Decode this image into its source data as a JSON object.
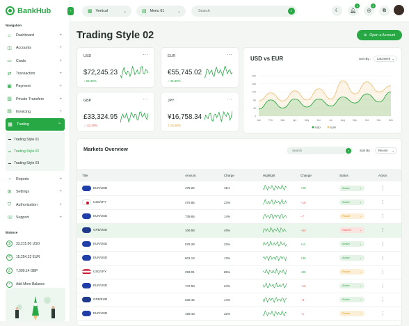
{
  "brand": {
    "name": "BankHub"
  },
  "sidebar": {
    "nav_title": "Navigation",
    "items": [
      {
        "label": "Dashboard",
        "icon": "home-icon"
      },
      {
        "label": "Accounts",
        "icon": "wallet-icon"
      },
      {
        "label": "Cards",
        "icon": "card-icon"
      },
      {
        "label": "Transaction",
        "icon": "transfer-icon"
      },
      {
        "label": "Payment",
        "icon": "payment-icon"
      },
      {
        "label": "Private Transfers",
        "icon": "bar-icon"
      },
      {
        "label": "Invoicing",
        "icon": "invoice-icon"
      },
      {
        "label": "Trading",
        "icon": "trading-icon"
      }
    ],
    "sub_items": [
      "Trading Style 01",
      "Trading Style 02",
      "Trading Style 03"
    ],
    "more_items": [
      {
        "label": "Reports",
        "icon": "reports-icon"
      },
      {
        "label": "Settings",
        "icon": "gear-icon"
      },
      {
        "label": "Authorization",
        "icon": "shield-icon"
      },
      {
        "label": "Support",
        "icon": "support-icon"
      }
    ],
    "balance_title": "Balance",
    "balances": [
      {
        "symbol": "$",
        "text": "33,215.00 USD"
      },
      {
        "symbol": "€",
        "text": "15,254.32 EUR"
      },
      {
        "symbol": "£",
        "text": "7,009.14 GBP"
      },
      {
        "symbol": "+",
        "text": "Add More Balance"
      }
    ]
  },
  "topbar": {
    "dropdown1": "Vertical",
    "dropdown2": "Menu 01",
    "search_placeholder": "Search",
    "badges": [
      "1",
      "2"
    ]
  },
  "page": {
    "title": "Trading Style 02",
    "open_account": "Open a Account"
  },
  "currency_cards": [
    {
      "code": "USD",
      "amount": "$72,245.23",
      "change": "↑ 28.30%",
      "trend": "up"
    },
    {
      "code": "EUR",
      "amount": "€55,745.02",
      "change": "↑ 45.30%",
      "trend": "up"
    },
    {
      "code": "GBP",
      "amount": "£33,324.95",
      "change": "↓ -12.30%",
      "trend": "down"
    },
    {
      "code": "JPY",
      "amount": "¥16,758.34",
      "change": "‡ 10.30%",
      "trend": "warn"
    }
  ],
  "chart_data": {
    "type": "area",
    "title": "USD vs EUR",
    "categories": [
      "Jan",
      "Feb",
      "Mar",
      "Apr",
      "May",
      "Jun",
      "Jul",
      "Aug",
      "Sep",
      "Oct",
      "Nov",
      "Dec"
    ],
    "ylim": [
      0,
      200
    ],
    "yticks": [
      0,
      40,
      80,
      120,
      160,
      200
    ],
    "series": [
      {
        "name": "USD",
        "color": "#27a844",
        "values": [
          35,
          80,
          40,
          85,
          45,
          85,
          50,
          95,
          65,
          110,
          70,
          120
        ]
      },
      {
        "name": "EUR",
        "color": "#f0c27b",
        "values": [
          75,
          115,
          75,
          125,
          80,
          135,
          85,
          175,
          110,
          170,
          120,
          150
        ]
      }
    ],
    "legend": "bottom",
    "grid": true
  },
  "chart_sort": {
    "label": "Sort By :",
    "value": "Last week"
  },
  "markets": {
    "title": "Markets Overview",
    "search_placeholder": "Search",
    "sort_label": "Sort By :",
    "sort_value": "Recent",
    "headers": [
      "Title",
      "Amount",
      "Charge",
      "Highlight",
      "Change",
      "Status",
      "Action"
    ],
    "rows": [
      {
        "title": "EUR/USD",
        "flag": "eu",
        "amount": "475.22",
        "charge": "11%",
        "change": "+25",
        "dir": "up",
        "status": "Active"
      },
      {
        "title": "USD/JPY",
        "flag": "jp",
        "amount": "475.85",
        "charge": "23%",
        "change": "−15",
        "dir": "down",
        "status": "Active"
      },
      {
        "title": "EUR/USD",
        "flag": "eu",
        "amount": "739.65",
        "charge": "14%",
        "change": "−7",
        "dir": "down",
        "status": "Pause"
      },
      {
        "title": "GPB/USD",
        "flag": "gb",
        "amount": "106.58",
        "charge": "45%",
        "change": "−54",
        "dir": "down",
        "status": "Cancel"
      },
      {
        "title": "EUR/USD",
        "flag": "eu",
        "amount": "578.28",
        "charge": "32%",
        "change": "+11",
        "dir": "up",
        "status": "Active"
      },
      {
        "title": "EUR/USD",
        "flag": "eu",
        "amount": "601.13",
        "charge": "12%",
        "change": "+36",
        "dir": "up",
        "status": "Active"
      },
      {
        "title": "USD/JPY",
        "flag": "us",
        "amount": "293.01",
        "charge": "86%",
        "change": "+85",
        "dir": "up",
        "status": "Pause"
      },
      {
        "title": "EUR/USD",
        "flag": "eu",
        "amount": "747.50",
        "charge": "24%",
        "change": "−12",
        "dir": "down",
        "status": "Active"
      },
      {
        "title": "GPB/EUR",
        "flag": "au",
        "amount": "630.44",
        "charge": "14%",
        "change": "−3",
        "dir": "down",
        "status": "Active"
      },
      {
        "title": "EUR/USD",
        "flag": "eu",
        "amount": "169.43",
        "charge": "32%",
        "change": "−1",
        "dir": "down",
        "status": "Pause"
      }
    ]
  },
  "colors": {
    "accent": "#27a844",
    "eur": "#f0c27b",
    "negative": "#e0564a",
    "pause": "#e39a1c"
  }
}
